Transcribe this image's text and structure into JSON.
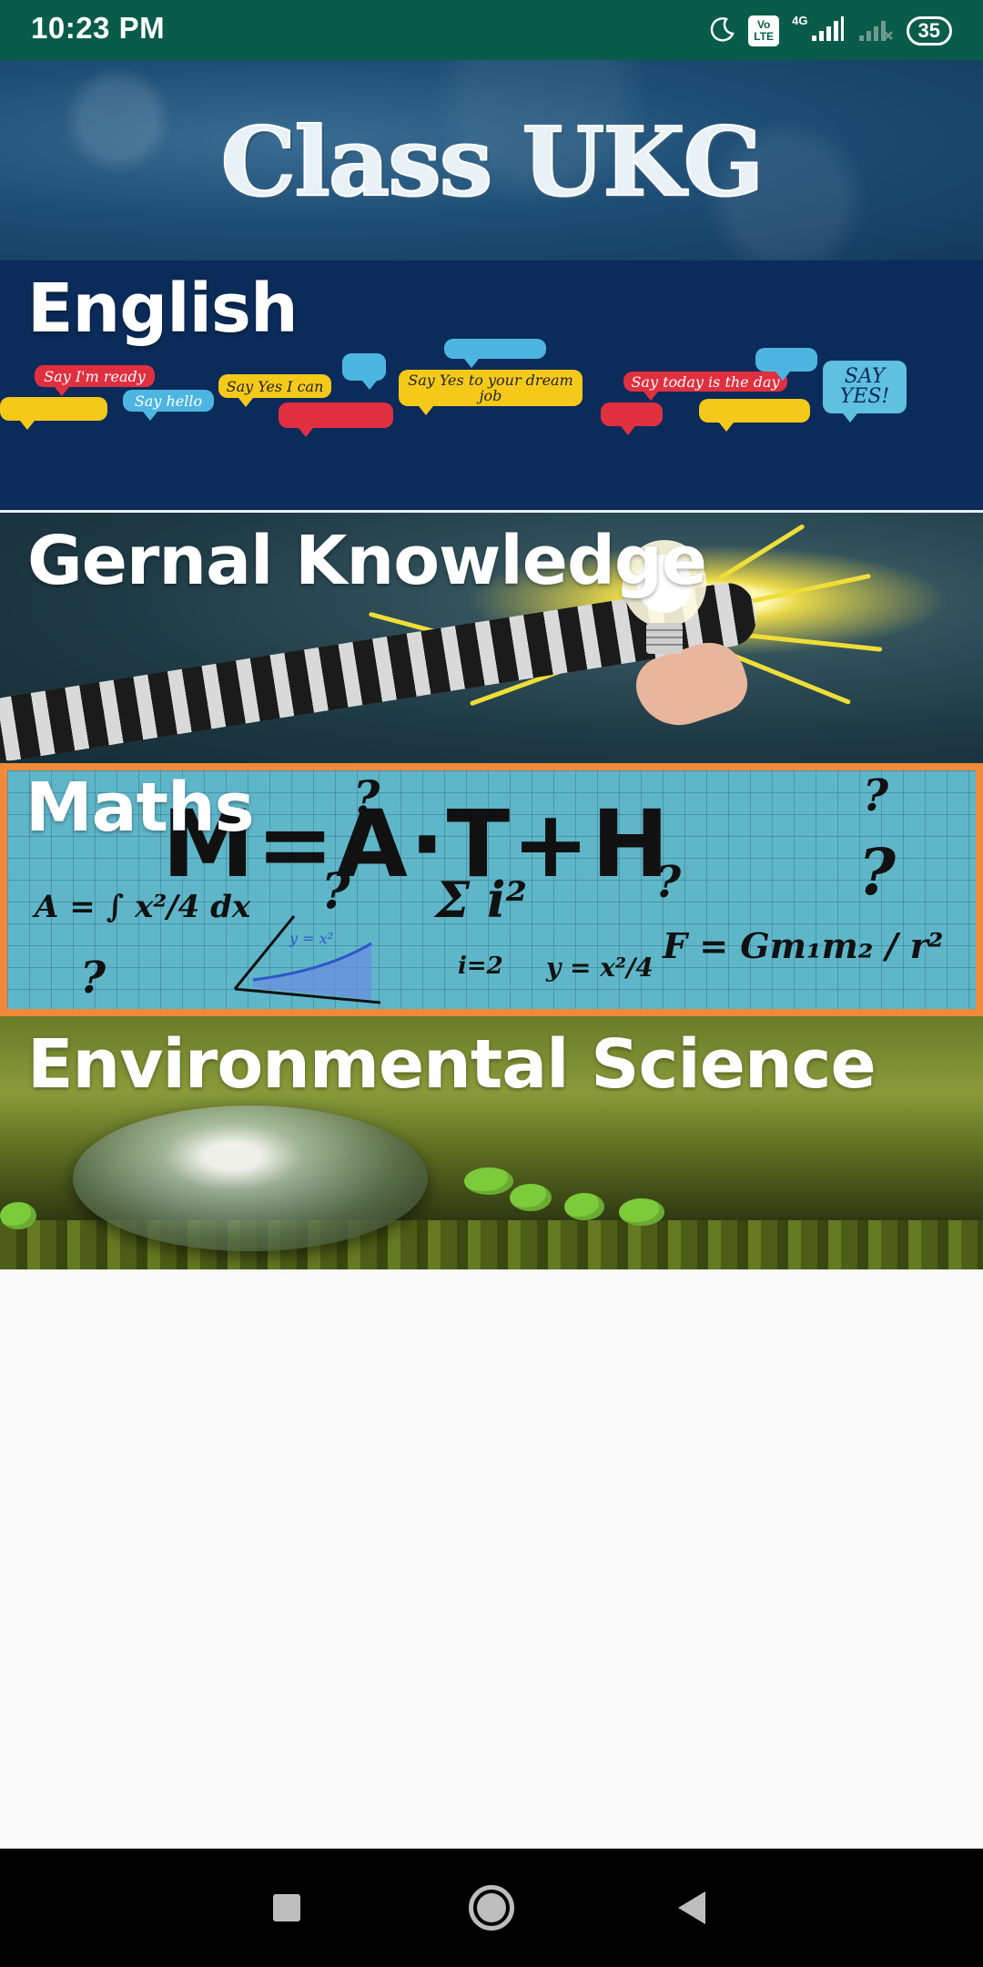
{
  "status_bar": {
    "time": "10:23 PM",
    "network_type": "4G",
    "volte_top": "Vo",
    "volte_bottom": "LTE",
    "battery": "35",
    "icons": [
      "moon-icon",
      "volte-icon",
      "signal-icon",
      "signal-no-sim-icon",
      "battery-icon"
    ]
  },
  "header": {
    "title": "Class UKG"
  },
  "subjects": [
    {
      "title": "English",
      "bubbles": [
        "Say I'm ready",
        "Say hello",
        "Say Yes I can",
        "Say Yes to your dream job",
        "Say today is the day",
        "SAY YES!"
      ]
    },
    {
      "title": "Gernal Knowledge"
    },
    {
      "title": "Maths",
      "banner": "M=A·T+H",
      "formulas": [
        "A = ∫ x²/4 dx",
        "Σ i²",
        "i=2",
        "y = x²/4",
        "F = Gm₁m₂ / r²",
        "y = x²"
      ]
    },
    {
      "title": "Environmental Science"
    }
  ],
  "nav_bar": {
    "icons": [
      "recent-apps-icon",
      "home-icon",
      "back-icon"
    ]
  },
  "colors": {
    "status_bar": "#0a5c4a",
    "english_bg": "#0b2b5a",
    "maths_border": "#f08a3a",
    "nav_bar": "#000000"
  }
}
